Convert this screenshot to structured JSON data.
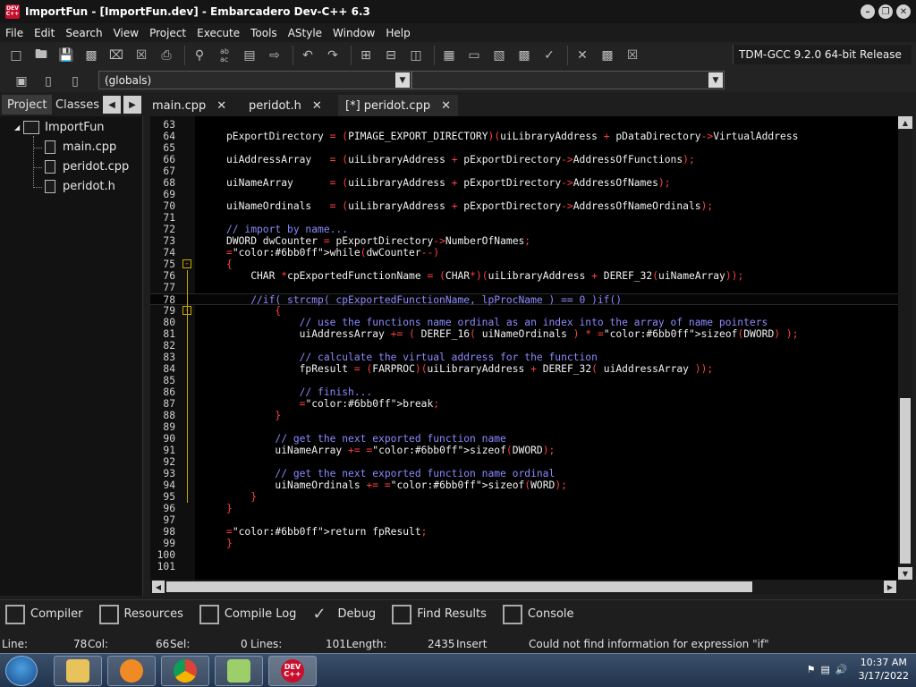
{
  "window": {
    "title": "ImportFun - [ImportFun.dev] - Embarcadero Dev-C++ 6.3",
    "app_icon_text": "DEV C++"
  },
  "menu": [
    "File",
    "Edit",
    "Search",
    "View",
    "Project",
    "Execute",
    "Tools",
    "AStyle",
    "Window",
    "Help"
  ],
  "toolbar": {
    "compiler": "TDM-GCC 9.2.0 64-bit Release",
    "scope": "(globals)"
  },
  "left_tabs": {
    "project": "Project",
    "classes": "Classes"
  },
  "editor_tabs": [
    {
      "label": "main.cpp"
    },
    {
      "label": "peridot.h"
    },
    {
      "label": "[*] peridot.cpp"
    }
  ],
  "project_tree": {
    "root": "ImportFun",
    "files": [
      "main.cpp",
      "peridot.cpp",
      "peridot.h"
    ]
  },
  "code_lines": [
    {
      "n": "63",
      "t": ""
    },
    {
      "n": "64",
      "t": "pExportDirectory = (PIMAGE_EXPORT_DIRECTORY)(uiLibraryAddress + pDataDirectory->VirtualAddress"
    },
    {
      "n": "65",
      "t": ""
    },
    {
      "n": "66",
      "t": "uiAddressArray   = (uiLibraryAddress + pExportDirectory->AddressOfFunctions);"
    },
    {
      "n": "67",
      "t": ""
    },
    {
      "n": "68",
      "t": "uiNameArray      = (uiLibraryAddress + pExportDirectory->AddressOfNames);"
    },
    {
      "n": "69",
      "t": ""
    },
    {
      "n": "70",
      "t": "uiNameOrdinals   = (uiLibraryAddress + pExportDirectory->AddressOfNameOrdinals);"
    },
    {
      "n": "71",
      "t": ""
    },
    {
      "n": "72",
      "t": "// import by name..."
    },
    {
      "n": "73",
      "t": "DWORD dwCounter = pExportDirectory->NumberOfNames;"
    },
    {
      "n": "74",
      "t": "while(dwCounter--)"
    },
    {
      "n": "75",
      "t": "{"
    },
    {
      "n": "76",
      "t": "    CHAR *cpExportedFunctionName = (CHAR*)(uiLibraryAddress + DEREF_32(uiNameArray));"
    },
    {
      "n": "77",
      "t": ""
    },
    {
      "n": "78",
      "t": "    //if( strcmp( cpExportedFunctionName, lpProcName ) == 0 )if()"
    },
    {
      "n": "79",
      "t": "        {"
    },
    {
      "n": "80",
      "t": "            // use the functions name ordinal as an index into the array of name pointers"
    },
    {
      "n": "81",
      "t": "            uiAddressArray += ( DEREF_16( uiNameOrdinals ) * sizeof(DWORD) );"
    },
    {
      "n": "82",
      "t": ""
    },
    {
      "n": "83",
      "t": "            // calculate the virtual address for the function"
    },
    {
      "n": "84",
      "t": "            fpResult = (FARPROC)(uiLibraryAddress + DEREF_32( uiAddressArray ));"
    },
    {
      "n": "85",
      "t": ""
    },
    {
      "n": "86",
      "t": "            // finish..."
    },
    {
      "n": "87",
      "t": "            break;"
    },
    {
      "n": "88",
      "t": "        }"
    },
    {
      "n": "89",
      "t": ""
    },
    {
      "n": "90",
      "t": "        // get the next exported function name"
    },
    {
      "n": "91",
      "t": "        uiNameArray += sizeof(DWORD);"
    },
    {
      "n": "92",
      "t": ""
    },
    {
      "n": "93",
      "t": "        // get the next exported function name ordinal"
    },
    {
      "n": "94",
      "t": "        uiNameOrdinals += sizeof(WORD);"
    },
    {
      "n": "95",
      "t": "    }"
    },
    {
      "n": "96",
      "t": "}"
    },
    {
      "n": "97",
      "t": ""
    },
    {
      "n": "98",
      "t": "return fpResult;"
    },
    {
      "n": "99",
      "t": "}"
    },
    {
      "n": "100",
      "t": ""
    },
    {
      "n": "101",
      "t": ""
    }
  ],
  "bottom_tabs": [
    "Compiler",
    "Resources",
    "Compile Log",
    "Debug",
    "Find Results",
    "Console"
  ],
  "status": {
    "line_label": "Line:",
    "line": "78",
    "col_label": "Col:",
    "col": "66",
    "sel_label": "Sel:",
    "sel": "0",
    "lines_label": "Lines:",
    "lines": "101",
    "length_label": "Length:",
    "length": "2435",
    "mode": "Insert",
    "message": "Could not find information for expression \"if\""
  },
  "taskbar": {
    "time": "10:37 AM",
    "date": "3/17/2022",
    "devcpp_label": "DEV C++"
  },
  "colors": {
    "editor_bg": "#000000",
    "fold_marker": "#c8a800",
    "comment": "#8a8aff",
    "operator": "#ff4040",
    "keyword": "#6bb0ff"
  }
}
